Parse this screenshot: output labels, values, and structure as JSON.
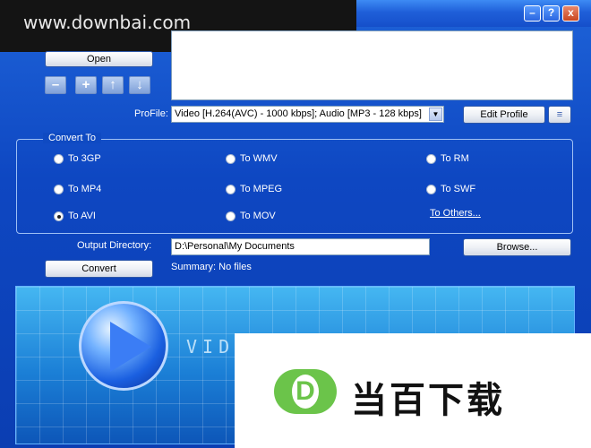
{
  "watermark": {
    "site": "www.downbai.com"
  },
  "titlebar": {
    "minimize": "–",
    "help": "?",
    "close": "x"
  },
  "toolbar": {
    "open_label": "Open",
    "remove_glyph": "–",
    "add_glyph": "+",
    "up_glyph": "↑",
    "down_glyph": "↓"
  },
  "profile": {
    "label": "ProFile:",
    "value": "Video [H.264(AVC) - 1000 kbps]; Audio [MP3 - 128 kbps]",
    "edit_label": "Edit Profile"
  },
  "convert_to": {
    "title": "Convert To",
    "options": [
      "To 3GP",
      "To WMV",
      "To RM",
      "To MP4",
      "To MPEG",
      "To SWF",
      "To AVI",
      "To MOV"
    ],
    "selected": "To AVI",
    "others_link": "To Others..."
  },
  "output": {
    "label": "Output Directory:",
    "value": "D:\\Personal\\My Documents",
    "browse_label": "Browse..."
  },
  "convert_label": "Convert",
  "summary": "Summary: No files",
  "banner": {
    "text": "VIDEO"
  },
  "logo": {
    "letter": "D",
    "text": "当百下载"
  }
}
